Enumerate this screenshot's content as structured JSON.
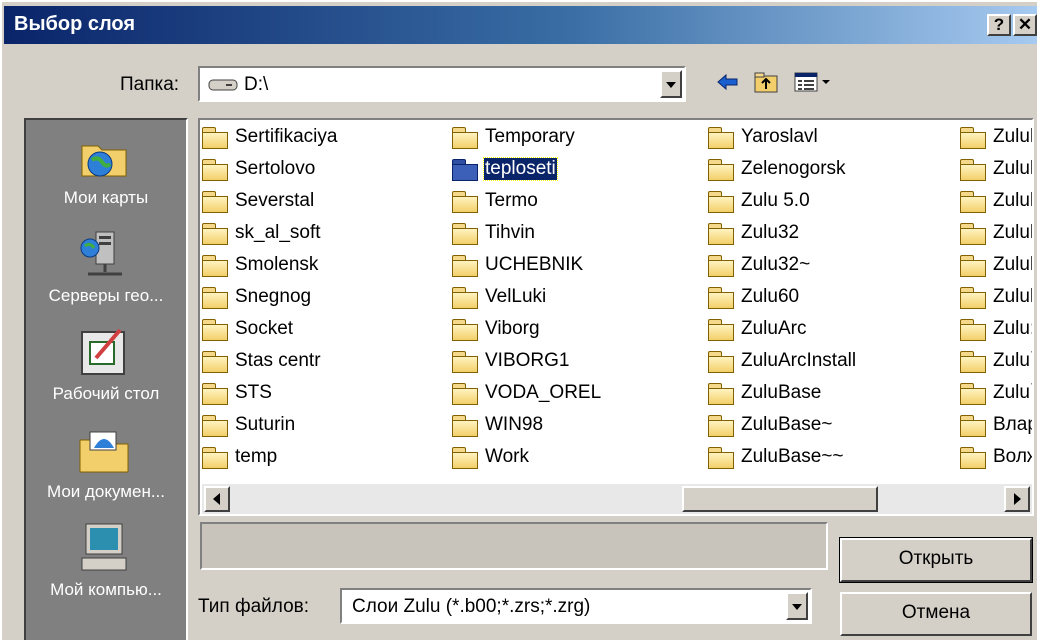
{
  "window": {
    "title": "Выбор слоя",
    "help_label": "?",
    "close_label": "✕"
  },
  "folder_bar": {
    "label": "Папка:",
    "value": "D:\\",
    "drive_icon": "drive-icon",
    "back_icon": "back-arrow-icon",
    "up_icon": "up-folder-icon",
    "view_icon": "view-menu-icon"
  },
  "places": [
    {
      "label": "Мои карты",
      "icon": "my-maps-icon"
    },
    {
      "label": "Серверы гео...",
      "icon": "servers-icon"
    },
    {
      "label": "Рабочий стол",
      "icon": "desktop-icon"
    },
    {
      "label": "Мои докумен...",
      "icon": "my-documents-icon"
    },
    {
      "label": "Мой компью...",
      "icon": "my-computer-icon"
    }
  ],
  "columns": [
    [
      "Sertifikaciya",
      "Sertolovo",
      "Severstal",
      "sk_al_soft",
      "Smolensk",
      "Snegnog",
      "Socket",
      "Stas centr",
      "STS",
      "Suturin",
      "temp"
    ],
    [
      "Temporary",
      "teploseti",
      "Termo",
      "Tihvin",
      "UCHEBNIK",
      "VelLuki",
      "Viborg",
      "VIBORG1",
      "VODA_OREL",
      "WIN98",
      "Work"
    ],
    [
      "Yaroslavl",
      "Zelenogorsk",
      "Zulu 5.0",
      "Zulu32",
      "Zulu32~",
      "Zulu60",
      "ZuluArc",
      "ZuluArcInstall",
      "ZuluBase",
      "ZuluBase~",
      "ZuluBase~~"
    ],
    [
      "Zulul",
      "Zulul",
      "Zulul",
      "Zulul",
      "Zulul",
      "Zulul",
      "Zulu:",
      "Zulu`",
      "Zulu`",
      "Влар",
      "Волж"
    ]
  ],
  "selected": {
    "column": 1,
    "row": 1
  },
  "file_type": {
    "label": "Тип файлов:",
    "value": "Слои Zulu (*.b00;*.zrs;*.zrg)"
  },
  "buttons": {
    "open": "Открыть",
    "cancel": "Отмена"
  }
}
